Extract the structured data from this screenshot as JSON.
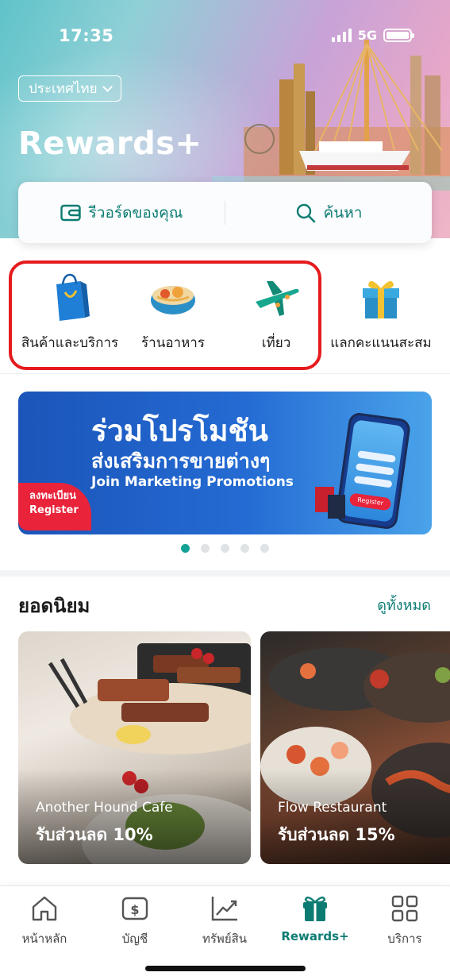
{
  "status_bar": {
    "time": "17:35",
    "network": "5G"
  },
  "header": {
    "country_selector": "ประเทศไทย",
    "title": "Rewards+"
  },
  "quick_actions": {
    "my_rewards": "รีวอร์ดของคุณ",
    "search": "ค้นหา"
  },
  "categories": [
    {
      "label": "สินค้าและบริการ",
      "icon": "shopping-bag-icon"
    },
    {
      "label": "ร้านอาหาร",
      "icon": "food-bowl-icon"
    },
    {
      "label": "เที่ยว",
      "icon": "airplane-icon"
    },
    {
      "label": "แลกคะแนนสะสม",
      "icon": "gift-box-icon"
    }
  ],
  "banner": {
    "line1": "ร่วมโปรโมชัน",
    "line2": "ส่งเสริมการขายต่างๆ",
    "line3": "Join Marketing Promotions",
    "register_th": "ลงทะเบียน",
    "register_en": "Register",
    "phone_button": "Register",
    "page_count": 5,
    "active_page": 1
  },
  "popular": {
    "title": "ยอดนิยม",
    "see_all": "ดูทั้งหมด",
    "items": [
      {
        "name": "Another Hound Cafe",
        "discount": "รับส่วนลด 10%"
      },
      {
        "name": "Flow Restaurant",
        "discount": "รับส่วนลด 15%"
      }
    ]
  },
  "tabbar": [
    {
      "label": "หน้าหลัก",
      "icon": "home-icon"
    },
    {
      "label": "บัญชี",
      "icon": "dollar-card-icon"
    },
    {
      "label": "ทรัพย์สิน",
      "icon": "chart-up-icon"
    },
    {
      "label": "Rewards+",
      "icon": "gift-icon",
      "active": true
    },
    {
      "label": "บริการ",
      "icon": "grid-icon"
    }
  ],
  "colors": {
    "accent": "#0c7c73",
    "highlight": "#e51b1e",
    "banner_blue": "#1b55b9"
  }
}
